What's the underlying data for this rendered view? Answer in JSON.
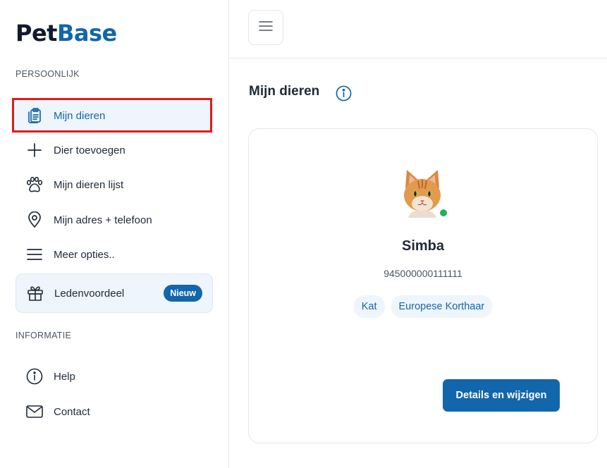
{
  "brand": {
    "logo_part1": "Pet",
    "logo_part2": "Base",
    "accent_color": "#1266ab"
  },
  "sidebar": {
    "section_personal": "PERSOONLIJK",
    "items": [
      {
        "label": "Mijn dieren",
        "icon": "clipboard-icon",
        "active": true
      },
      {
        "label": "Dier toevoegen",
        "icon": "plus-icon"
      },
      {
        "label": "Mijn dieren lijst",
        "icon": "paw-icon"
      },
      {
        "label": "Mijn adres + telefoon",
        "icon": "location-pin-icon"
      },
      {
        "label": "Meer opties..",
        "icon": "menu-icon"
      }
    ],
    "promo": {
      "label": "Ledenvoordeel",
      "badge": "Nieuw",
      "icon": "gift-icon"
    },
    "section_info": "INFORMATIE",
    "info_items": [
      {
        "label": "Help",
        "icon": "info-icon"
      },
      {
        "label": "Contact",
        "icon": "mail-icon"
      }
    ]
  },
  "main": {
    "title": "Mijn dieren",
    "pet": {
      "name": "Simba",
      "chip_number": "945000000111111",
      "tags": [
        "Kat",
        "Europese Korthaar"
      ],
      "status_color": "#22b15a",
      "details_button": "Details en wijzigen"
    }
  }
}
